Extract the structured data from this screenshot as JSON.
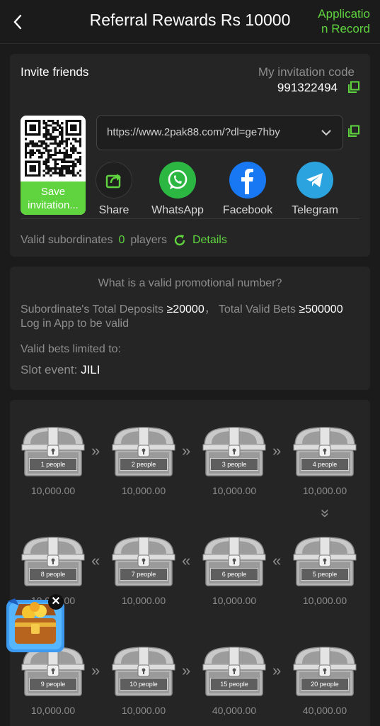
{
  "header": {
    "title": "Referral Rewards Rs 10000",
    "application_record": "Application Record"
  },
  "invite": {
    "title": "Invite friends",
    "code_label": "My invitation code",
    "code": "991322494",
    "save_label": "Save invitation...",
    "link": "https://www.2pak88.com/?dl=ge7hby",
    "share_targets": [
      "Share",
      "WhatsApp",
      "Facebook",
      "Telegram"
    ],
    "subordinates_label": "Valid subordinates",
    "subordinates_count": "0",
    "subordinates_unit": "players",
    "details": "Details"
  },
  "rules": {
    "question": "What is a valid promotional number?",
    "part1": "Subordinate's Total Deposits ",
    "deposits": "≥20000",
    "part2": "， Total Valid Bets ",
    "bets": "≥500000",
    "part3": " Log in App to be valid",
    "limit_label": "Valid bets limited to:",
    "slot_label": "Slot event: ",
    "slot_value": "JILI"
  },
  "rewards": [
    {
      "label": "1 people",
      "amount": "10,000.00"
    },
    {
      "label": "2 people",
      "amount": "10,000.00"
    },
    {
      "label": "3 people",
      "amount": "10,000.00"
    },
    {
      "label": "4 people",
      "amount": "10,000.00"
    },
    {
      "label": "5 people",
      "amount": "10,000.00"
    },
    {
      "label": "6 people",
      "amount": "10,000.00"
    },
    {
      "label": "7 people",
      "amount": "10,000.00"
    },
    {
      "label": "8 people",
      "amount": "10,000.00"
    },
    {
      "label": "9 people",
      "amount": "10,000.00"
    },
    {
      "label": "10 people",
      "amount": "10,000.00"
    },
    {
      "label": "15 people",
      "amount": "40,000.00"
    },
    {
      "label": "20 people",
      "amount": "40,000.00"
    }
  ],
  "colors": {
    "accent": "#5fd43f",
    "background": "#1b1b1b",
    "card": "#252525"
  }
}
